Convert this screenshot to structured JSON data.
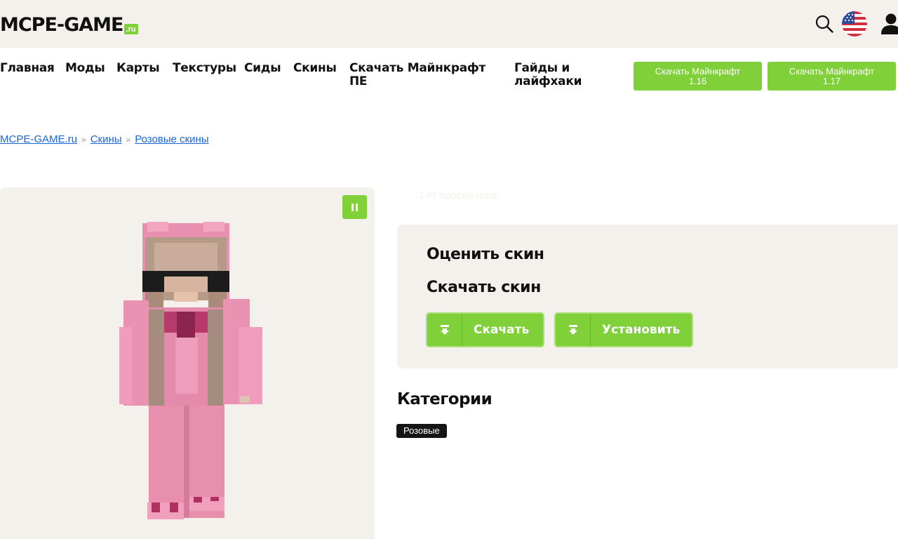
{
  "header": {
    "logo_main": "MCPE-GAME",
    "logo_suffix": ".ru",
    "icons": [
      "search-icon",
      "us-flag-icon",
      "user-icon"
    ]
  },
  "nav": {
    "items": [
      {
        "label": "Главная"
      },
      {
        "label": "Моды"
      },
      {
        "label": "Карты"
      },
      {
        "label": "Текстуры"
      },
      {
        "label": "Сиды"
      },
      {
        "label": "Скины"
      },
      {
        "label": "Скачать Майнкрафт ПЕ"
      },
      {
        "label": "Гайды и лайфхаки"
      }
    ],
    "download_buttons": [
      {
        "line1": "Скачать Майнкрафт",
        "line2": "1.16"
      },
      {
        "line1": "Скачать Майнкрафт",
        "line2": "1.17"
      }
    ]
  },
  "breadcrumb": {
    "items": [
      "MCPE-GAME.ru",
      "Скины",
      "Розовые скины"
    ],
    "separator": "»"
  },
  "skin": {
    "views": "149 просмотров"
  },
  "card": {
    "rate_title": "Оценить скин",
    "download_title": "Скачать скин",
    "download_label": "Скачать",
    "install_label": "Установить"
  },
  "categories": {
    "title": "Категории",
    "tags": [
      "Розовые"
    ]
  },
  "colors": {
    "accent": "#7fd039",
    "panel": "#f4f1ec",
    "link": "#1a66d6",
    "tag_bg": "#151515"
  }
}
